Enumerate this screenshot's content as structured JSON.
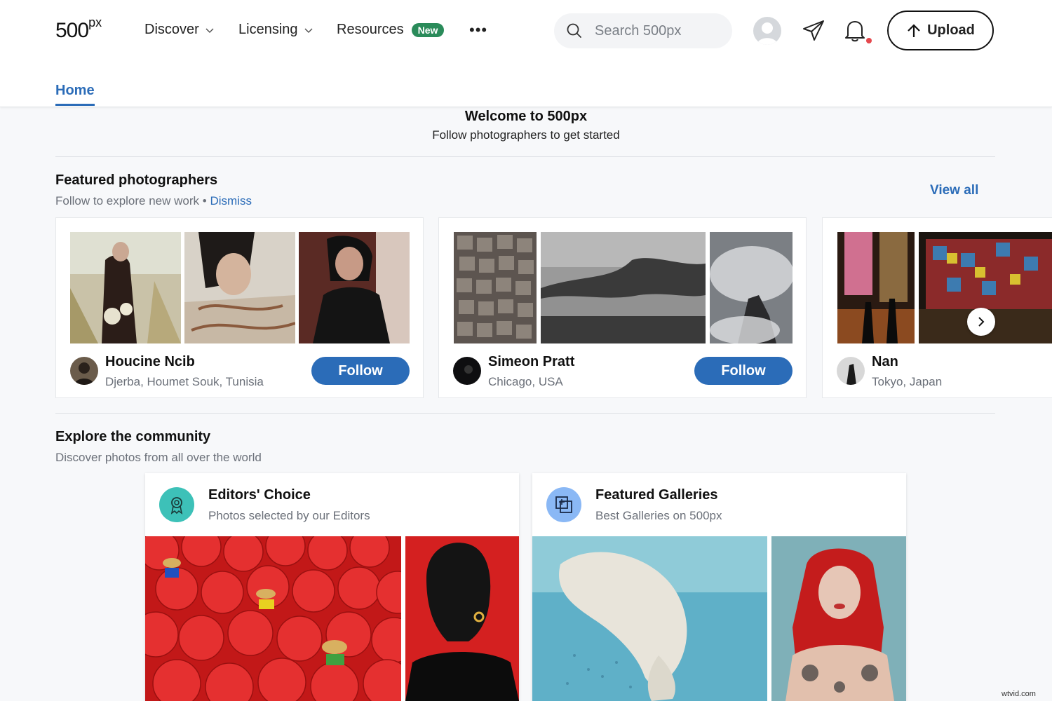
{
  "header": {
    "logo_main": "500",
    "logo_sup": "px",
    "nav": [
      {
        "label": "Discover"
      },
      {
        "label": "Licensing"
      },
      {
        "label": "Resources",
        "badge": "New"
      }
    ],
    "more_label": "•••",
    "search_placeholder": "Search 500px",
    "upload_label": "Upload"
  },
  "tabs": {
    "home": "Home"
  },
  "welcome": {
    "title": "Welcome to 500px",
    "subtitle": "Follow photographers to get started"
  },
  "featured": {
    "title": "Featured photographers",
    "subtitle": "Follow to explore new work",
    "separator": "•",
    "dismiss": "Dismiss",
    "view_all": "View all",
    "photographers": [
      {
        "name": "Houcine Ncib",
        "location": "Djerba, Houmet Souk, Tunisia",
        "follow": "Follow"
      },
      {
        "name": "Simeon Pratt",
        "location": "Chicago, USA",
        "follow": "Follow"
      },
      {
        "name": "Nan",
        "location": "Tokyo, Japan"
      }
    ]
  },
  "community": {
    "title": "Explore the community",
    "subtitle": "Discover photos from all over the world",
    "cards": [
      {
        "title": "Editors' Choice",
        "subtitle": "Photos selected by our Editors",
        "icon": "award-ribbon-icon",
        "icon_bg": "#3dc1b8"
      },
      {
        "title": "Featured Galleries",
        "subtitle": "Best Galleries on 500px",
        "icon": "gallery-add-icon",
        "icon_bg": "#8ab8f5"
      }
    ]
  },
  "colors": {
    "accent": "#2b6cb8",
    "badge": "#2a8b5a",
    "notification": "#e5484d"
  },
  "watermark": "wtvid.com"
}
